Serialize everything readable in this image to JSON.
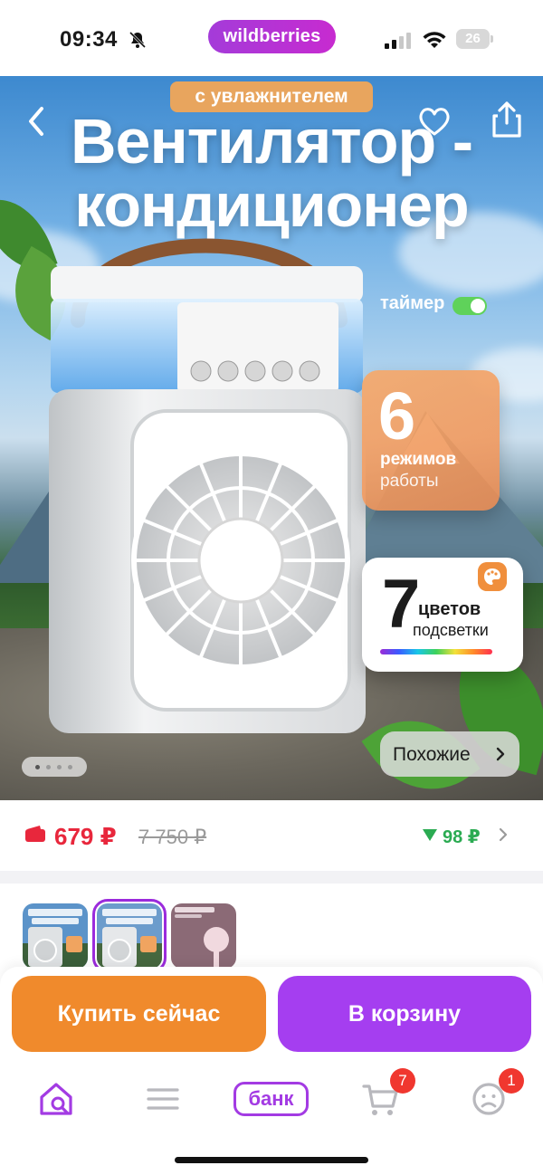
{
  "status_bar": {
    "time": "09:34",
    "brand": "wildberries",
    "battery": "26"
  },
  "hero": {
    "tag": "с увлажнителем",
    "headline_line1": "Вентилятор -",
    "headline_line2": "кондиционер",
    "timer_label": "таймер",
    "modes_number": "6",
    "modes_line1": "режимов",
    "modes_line2": "работы",
    "colors_number": "7",
    "colors_line1": "цветов",
    "colors_line2": "подсветки",
    "similar_label": "Похожие",
    "gallery": {
      "current": 1,
      "total": 4
    }
  },
  "price": {
    "current": "679 ₽",
    "old": "7 750 ₽",
    "cashback": "98 ₽"
  },
  "actions": {
    "buy_now": "Купить сейчас",
    "add_to_cart": "В корзину"
  },
  "tab_bar": {
    "bank_label": "банк",
    "cart_count": "7",
    "profile_count": "1"
  },
  "colors": {
    "brand_purple": "#a33be3",
    "buy_orange": "#f08a2c",
    "price_red": "#e8273c",
    "cashback_green": "#2bab52",
    "badge_red": "#f0372f"
  }
}
